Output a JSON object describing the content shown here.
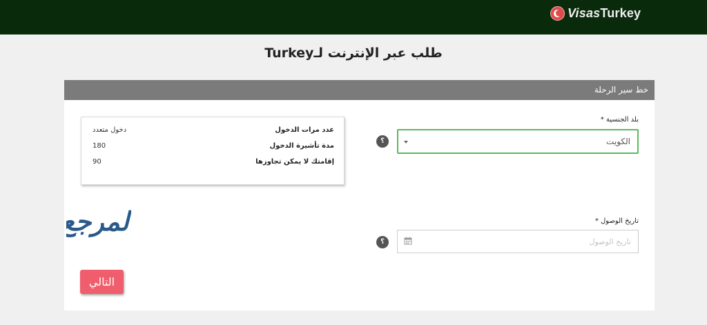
{
  "brand": {
    "prefix": "Visas",
    "suffix": "Turkey",
    "flag_color": "#e04a4a"
  },
  "page": {
    "title": "طلب عبر الإنترنت لـTurkey"
  },
  "section": {
    "title": "خط سير الرحلة"
  },
  "form": {
    "nationality_label": "بلد الجنسية",
    "nationality_value": "الكويت",
    "arrival_label": "تاريخ الوصول",
    "arrival_placeholder": "تاريخ الوصول",
    "required_mark": "*",
    "help_symbol": "؟"
  },
  "summary": {
    "rows": [
      {
        "label": "عدد مرات الدخول",
        "value": "دخول متعدد"
      },
      {
        "label": "مدة تأشيرة الدخول",
        "value": "180"
      },
      {
        "label": "إقامتك لا يمكن تجاوزها",
        "value": "90"
      }
    ]
  },
  "watermark": {
    "text": "المرجع",
    "color": "#2a5a8a"
  },
  "actions": {
    "next_label": "التالي"
  },
  "colors": {
    "topbar": "#0a2a0c",
    "accent_green": "#5cb85c",
    "button": "#f05d6c",
    "header_gray": "#7b7b7b"
  },
  "icons": {
    "flag": "turkey-flag-icon",
    "caret": "chevron-down-icon",
    "calendar": "calendar-icon",
    "help": "help-icon"
  }
}
